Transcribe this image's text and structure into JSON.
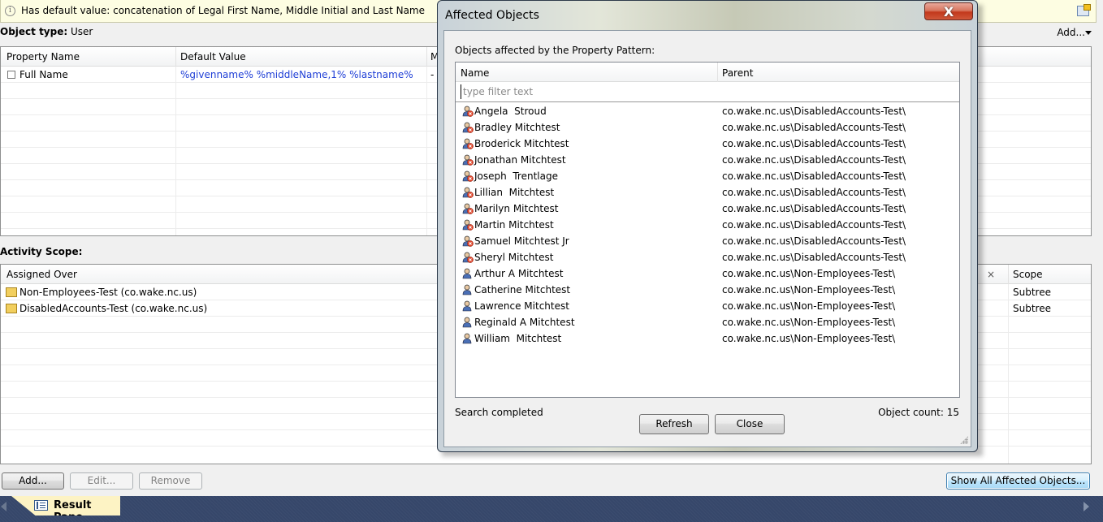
{
  "infobar": {
    "icon": "info-icon",
    "text": "Has default value: concatenation of Legal First Name, Middle Initial and Last Name",
    "right_icon": "properties-icon"
  },
  "object_type": {
    "label": "Object type:",
    "value": "User"
  },
  "add_menu": {
    "label": "Add...",
    "icon": "chevron-down-icon"
  },
  "property_grid": {
    "columns": [
      "Property Name",
      "Default Value",
      "M"
    ],
    "rows": [
      {
        "icon": "collapse-icon",
        "name": "Full Name",
        "default_value": "%givenname% %middleName,1% %lastname%",
        "third": "-"
      }
    ],
    "value_color": "#1f3fd6"
  },
  "activity_scope": {
    "label": "Activity Scope:",
    "columns": [
      "Assigned Over",
      "Scope"
    ],
    "remove_column_glyph": "×",
    "rows": [
      {
        "icon": "container-icon",
        "name": "Non-Employees-Test (co.wake.nc.us)",
        "scope": "Subtree"
      },
      {
        "icon": "container-icon",
        "name": "DisabledAccounts-Test (co.wake.nc.us)",
        "scope": "Subtree"
      }
    ],
    "buttons": {
      "add": "Add...",
      "edit": "Edit...",
      "remove": "Remove"
    },
    "show_all_button": "Show All Affected Objects..."
  },
  "bottom_tab": {
    "label": "Result Pane",
    "icon": "result-pane-icon"
  },
  "dialog": {
    "title": "Affected Objects",
    "close_glyph": "X",
    "caption": "Objects affected by the Property Pattern:",
    "columns": [
      "Name",
      "Parent"
    ],
    "filter_placeholder": "type filter text",
    "filter_value": "",
    "objects": [
      {
        "name": "Angela  Stroud",
        "parent": "co.wake.nc.us\\DisabledAccounts-Test\\",
        "status": "disabled"
      },
      {
        "name": "Bradley Mitchtest",
        "parent": "co.wake.nc.us\\DisabledAccounts-Test\\",
        "status": "disabled"
      },
      {
        "name": "Broderick Mitchtest",
        "parent": "co.wake.nc.us\\DisabledAccounts-Test\\",
        "status": "disabled"
      },
      {
        "name": "Jonathan Mitchtest",
        "parent": "co.wake.nc.us\\DisabledAccounts-Test\\",
        "status": "disabled"
      },
      {
        "name": "Joseph  Trentlage",
        "parent": "co.wake.nc.us\\DisabledAccounts-Test\\",
        "status": "disabled"
      },
      {
        "name": "Lillian  Mitchtest",
        "parent": "co.wake.nc.us\\DisabledAccounts-Test\\",
        "status": "disabled"
      },
      {
        "name": "Marilyn Mitchtest",
        "parent": "co.wake.nc.us\\DisabledAccounts-Test\\",
        "status": "disabled"
      },
      {
        "name": "Martin Mitchtest",
        "parent": "co.wake.nc.us\\DisabledAccounts-Test\\",
        "status": "disabled"
      },
      {
        "name": "Samuel Mitchtest Jr",
        "parent": "co.wake.nc.us\\DisabledAccounts-Test\\",
        "status": "disabled"
      },
      {
        "name": "Sheryl Mitchtest",
        "parent": "co.wake.nc.us\\DisabledAccounts-Test\\",
        "status": "disabled"
      },
      {
        "name": "Arthur A Mitchtest",
        "parent": "co.wake.nc.us\\Non-Employees-Test\\",
        "status": "enabled"
      },
      {
        "name": "Catherine Mitchtest",
        "parent": "co.wake.nc.us\\Non-Employees-Test\\",
        "status": "enabled"
      },
      {
        "name": "Lawrence Mitchtest",
        "parent": "co.wake.nc.us\\Non-Employees-Test\\",
        "status": "enabled"
      },
      {
        "name": "Reginald A Mitchtest",
        "parent": "co.wake.nc.us\\Non-Employees-Test\\",
        "status": "enabled"
      },
      {
        "name": "William  Mitchtest",
        "parent": "co.wake.nc.us\\Non-Employees-Test\\",
        "status": "enabled"
      }
    ],
    "status_text": "Search completed",
    "object_count_label": "Object count: 15",
    "buttons": {
      "refresh": "Refresh",
      "close": "Close"
    }
  }
}
